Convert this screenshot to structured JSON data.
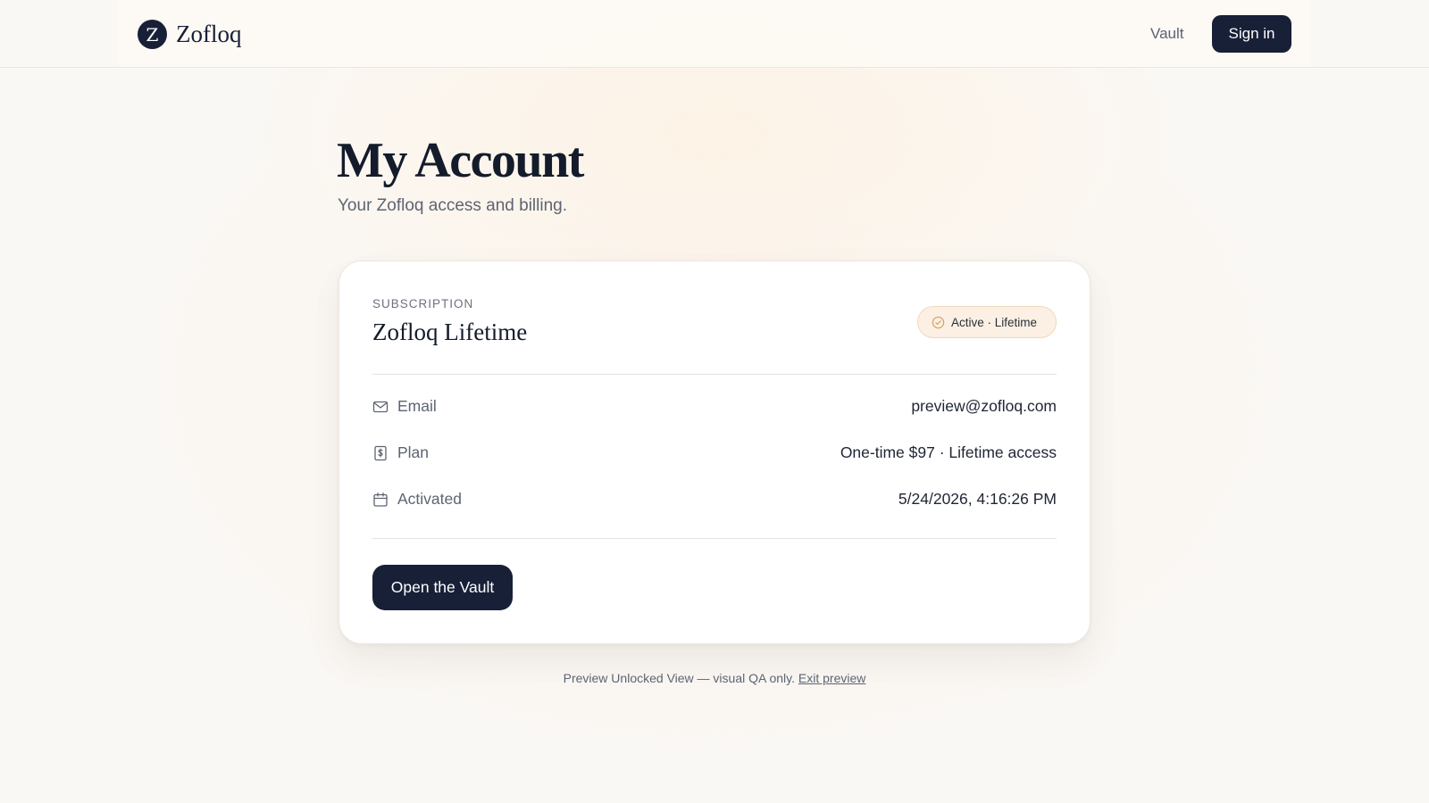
{
  "header": {
    "brand_initial": "Z",
    "brand_name": "Zofloq",
    "nav_vault": "Vault",
    "signin_label": "Sign in"
  },
  "page": {
    "title": "My Account",
    "subtitle": "Your Zofloq access and billing."
  },
  "subscription": {
    "section_label": "SUBSCRIPTION",
    "plan_name": "Zofloq Lifetime",
    "status_badge": "Active · Lifetime",
    "rows": [
      {
        "icon": "mail-icon",
        "label": "Email",
        "value": "preview@zofloq.com"
      },
      {
        "icon": "receipt-dollar-icon",
        "label": "Plan",
        "value": "One-time $97 · Lifetime access"
      },
      {
        "icon": "calendar-icon",
        "label": "Activated",
        "value": "5/24/2026, 4:16:26 PM"
      }
    ],
    "cta_label": "Open the Vault"
  },
  "footer": {
    "note": "Preview Unlocked View — visual QA only.",
    "exit_link": "Exit preview"
  },
  "colors": {
    "primary": "#172037",
    "background": "#faf8f5",
    "badge_bg": "#fbf0e3",
    "badge_icon": "#d9a066"
  }
}
